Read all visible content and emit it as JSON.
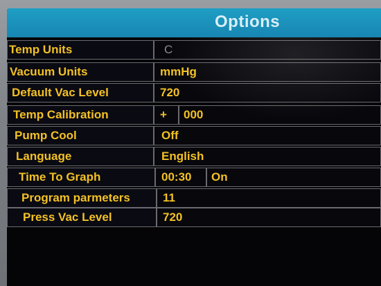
{
  "screen": {
    "title": "Options"
  },
  "options": [
    {
      "label": "Temp Units",
      "value": "C"
    },
    {
      "label": "Vacuum Units",
      "value": "mmHg"
    },
    {
      "label": "Default Vac Level",
      "value": "720"
    },
    {
      "label": "Temp Calibration",
      "sign": "+",
      "value": "000"
    },
    {
      "label": "Pump Cool",
      "value": "Off"
    },
    {
      "label": "Language",
      "value": "English"
    },
    {
      "label": "Time To Graph",
      "value": "00:30",
      "state": "On"
    },
    {
      "label": "Program parmeters",
      "value": "11"
    },
    {
      "label": "Press Vac Level",
      "value": "720"
    }
  ],
  "colors": {
    "title_bar": "#1786b2",
    "text": "#f3c125",
    "background": "#050507"
  }
}
